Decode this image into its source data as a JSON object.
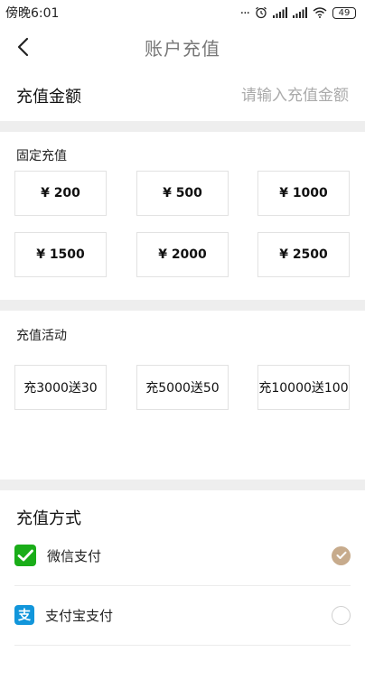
{
  "status_bar": {
    "time": "傍晚6:01",
    "dots": "...",
    "battery": "49",
    "icons": [
      "alarm-icon",
      "signal-icon",
      "signal-icon",
      "wifi-icon",
      "battery-icon"
    ]
  },
  "header": {
    "title": "账户充值",
    "back_icon": "chevron-left-icon"
  },
  "amount": {
    "label": "充值金额",
    "placeholder": "请输入充值金额"
  },
  "fixed": {
    "label": "固定充值",
    "options": [
      "¥ 200",
      "¥ 500",
      "¥ 1000",
      "¥ 1500",
      "¥ 2000",
      "¥ 2500"
    ]
  },
  "promo": {
    "label": "充值活动",
    "options": [
      "充3000送30",
      "充5000送50",
      "充10000送100"
    ]
  },
  "payment": {
    "title": "充值方式",
    "methods": [
      {
        "name": "微信支付",
        "icon": "wechat-pay-icon",
        "selected": true,
        "color": "#1aad19"
      },
      {
        "name": "支付宝支付",
        "icon": "alipay-icon",
        "selected": false,
        "color": "#1296db"
      }
    ],
    "selected_color": "#c7ab8c"
  }
}
